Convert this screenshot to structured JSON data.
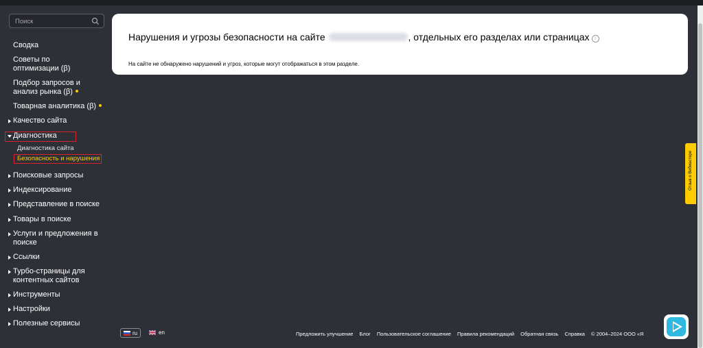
{
  "search": {
    "placeholder": "Поиск"
  },
  "nav": {
    "items": [
      {
        "label": "Сводка"
      },
      {
        "label": "Советы по оптимизации (β)"
      },
      {
        "label": "Подбор запросов и анализ рынка (β)"
      },
      {
        "label": "Товарная аналитика (β)"
      },
      {
        "label": "Качество сайта"
      },
      {
        "label": "Диагностика"
      },
      {
        "label": "Поисковые запросы"
      },
      {
        "label": "Индексирование"
      },
      {
        "label": "Представление в поиске"
      },
      {
        "label": "Товары в поиске"
      },
      {
        "label": "Услуги и предложения в поиске"
      },
      {
        "label": "Ссылки"
      },
      {
        "label": "Турбо-страницы для контентных сайтов"
      },
      {
        "label": "Инструменты"
      },
      {
        "label": "Настройки"
      },
      {
        "label": "Полезные сервисы"
      }
    ],
    "sub": [
      {
        "label": "Диагностика сайта"
      },
      {
        "label": "Безопасность и нарушения"
      }
    ]
  },
  "main": {
    "title_prefix": "Нарушения и угрозы безопасности на сайте",
    "title_suffix": ", отдельных его разделах или страницах",
    "message": "На сайте не обнаружено нарушений и угроз, которые могут отображаться в этом разделе."
  },
  "lang": {
    "ru": "ru",
    "en": "en"
  },
  "footer": {
    "links": [
      "Предложить улучшение",
      "Блог",
      "Пользовательское соглашение",
      "Правила рекомендаций",
      "Обратная связь",
      "Справка"
    ],
    "copyright": "© 2004–2024 ООО «Я"
  },
  "feedback_tab": {
    "label": "Отзыв о Вебмастере"
  },
  "colors": {
    "background": "#2e3038",
    "accent": "#ffcc00",
    "highlight_box": "#e0202a"
  }
}
